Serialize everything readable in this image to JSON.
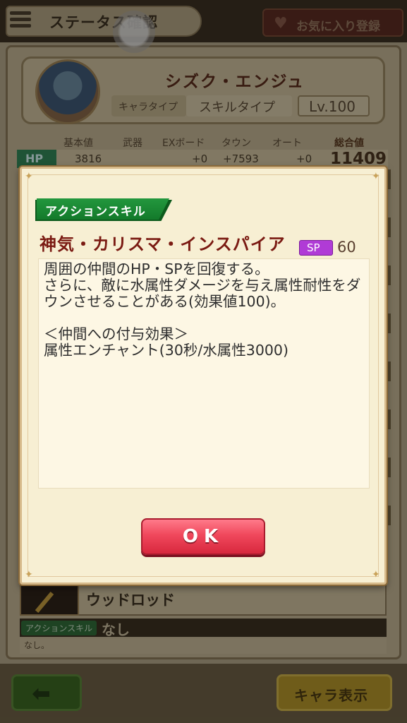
{
  "header": {
    "title": "ステータス確認",
    "favorite_label": "お気に入り登録"
  },
  "character": {
    "name": "シズク・エンジュ",
    "char_type_label": "キャラタイプ",
    "skill_type_label": "スキルタイプ",
    "level": "Lv.100"
  },
  "stats": {
    "headers": [
      "基本値",
      "武器",
      "EXボード",
      "タウン",
      "オート",
      "総合値"
    ],
    "hp": {
      "label": "HP",
      "base": "3816",
      "weapon": "",
      "ex_board": "+0",
      "town": "+7593",
      "auto": "+0",
      "total": "11409"
    }
  },
  "weapon": {
    "name": "ウッドロッド",
    "action_skill_label": "アクションスキル",
    "action_skill_value": "なし",
    "description": "なし。"
  },
  "dialog": {
    "ribbon": "アクションスキル",
    "skill_name": "神気・カリスマ・インスパイア",
    "sp_label": "SP",
    "sp_value": "60",
    "description": "周囲の仲間のHP・SPを回復する。\nさらに、敵に水属性ダメージを与え属性耐性をダウンさせることがある(効果値100)。\n\n＜仲間への付与効果＞\n属性エンチャント(30秒/水属性3000)",
    "ok_label": "OK"
  },
  "footer": {
    "back_icon": "left-arrow-icon",
    "chara_view_label": "キャラ表示"
  }
}
